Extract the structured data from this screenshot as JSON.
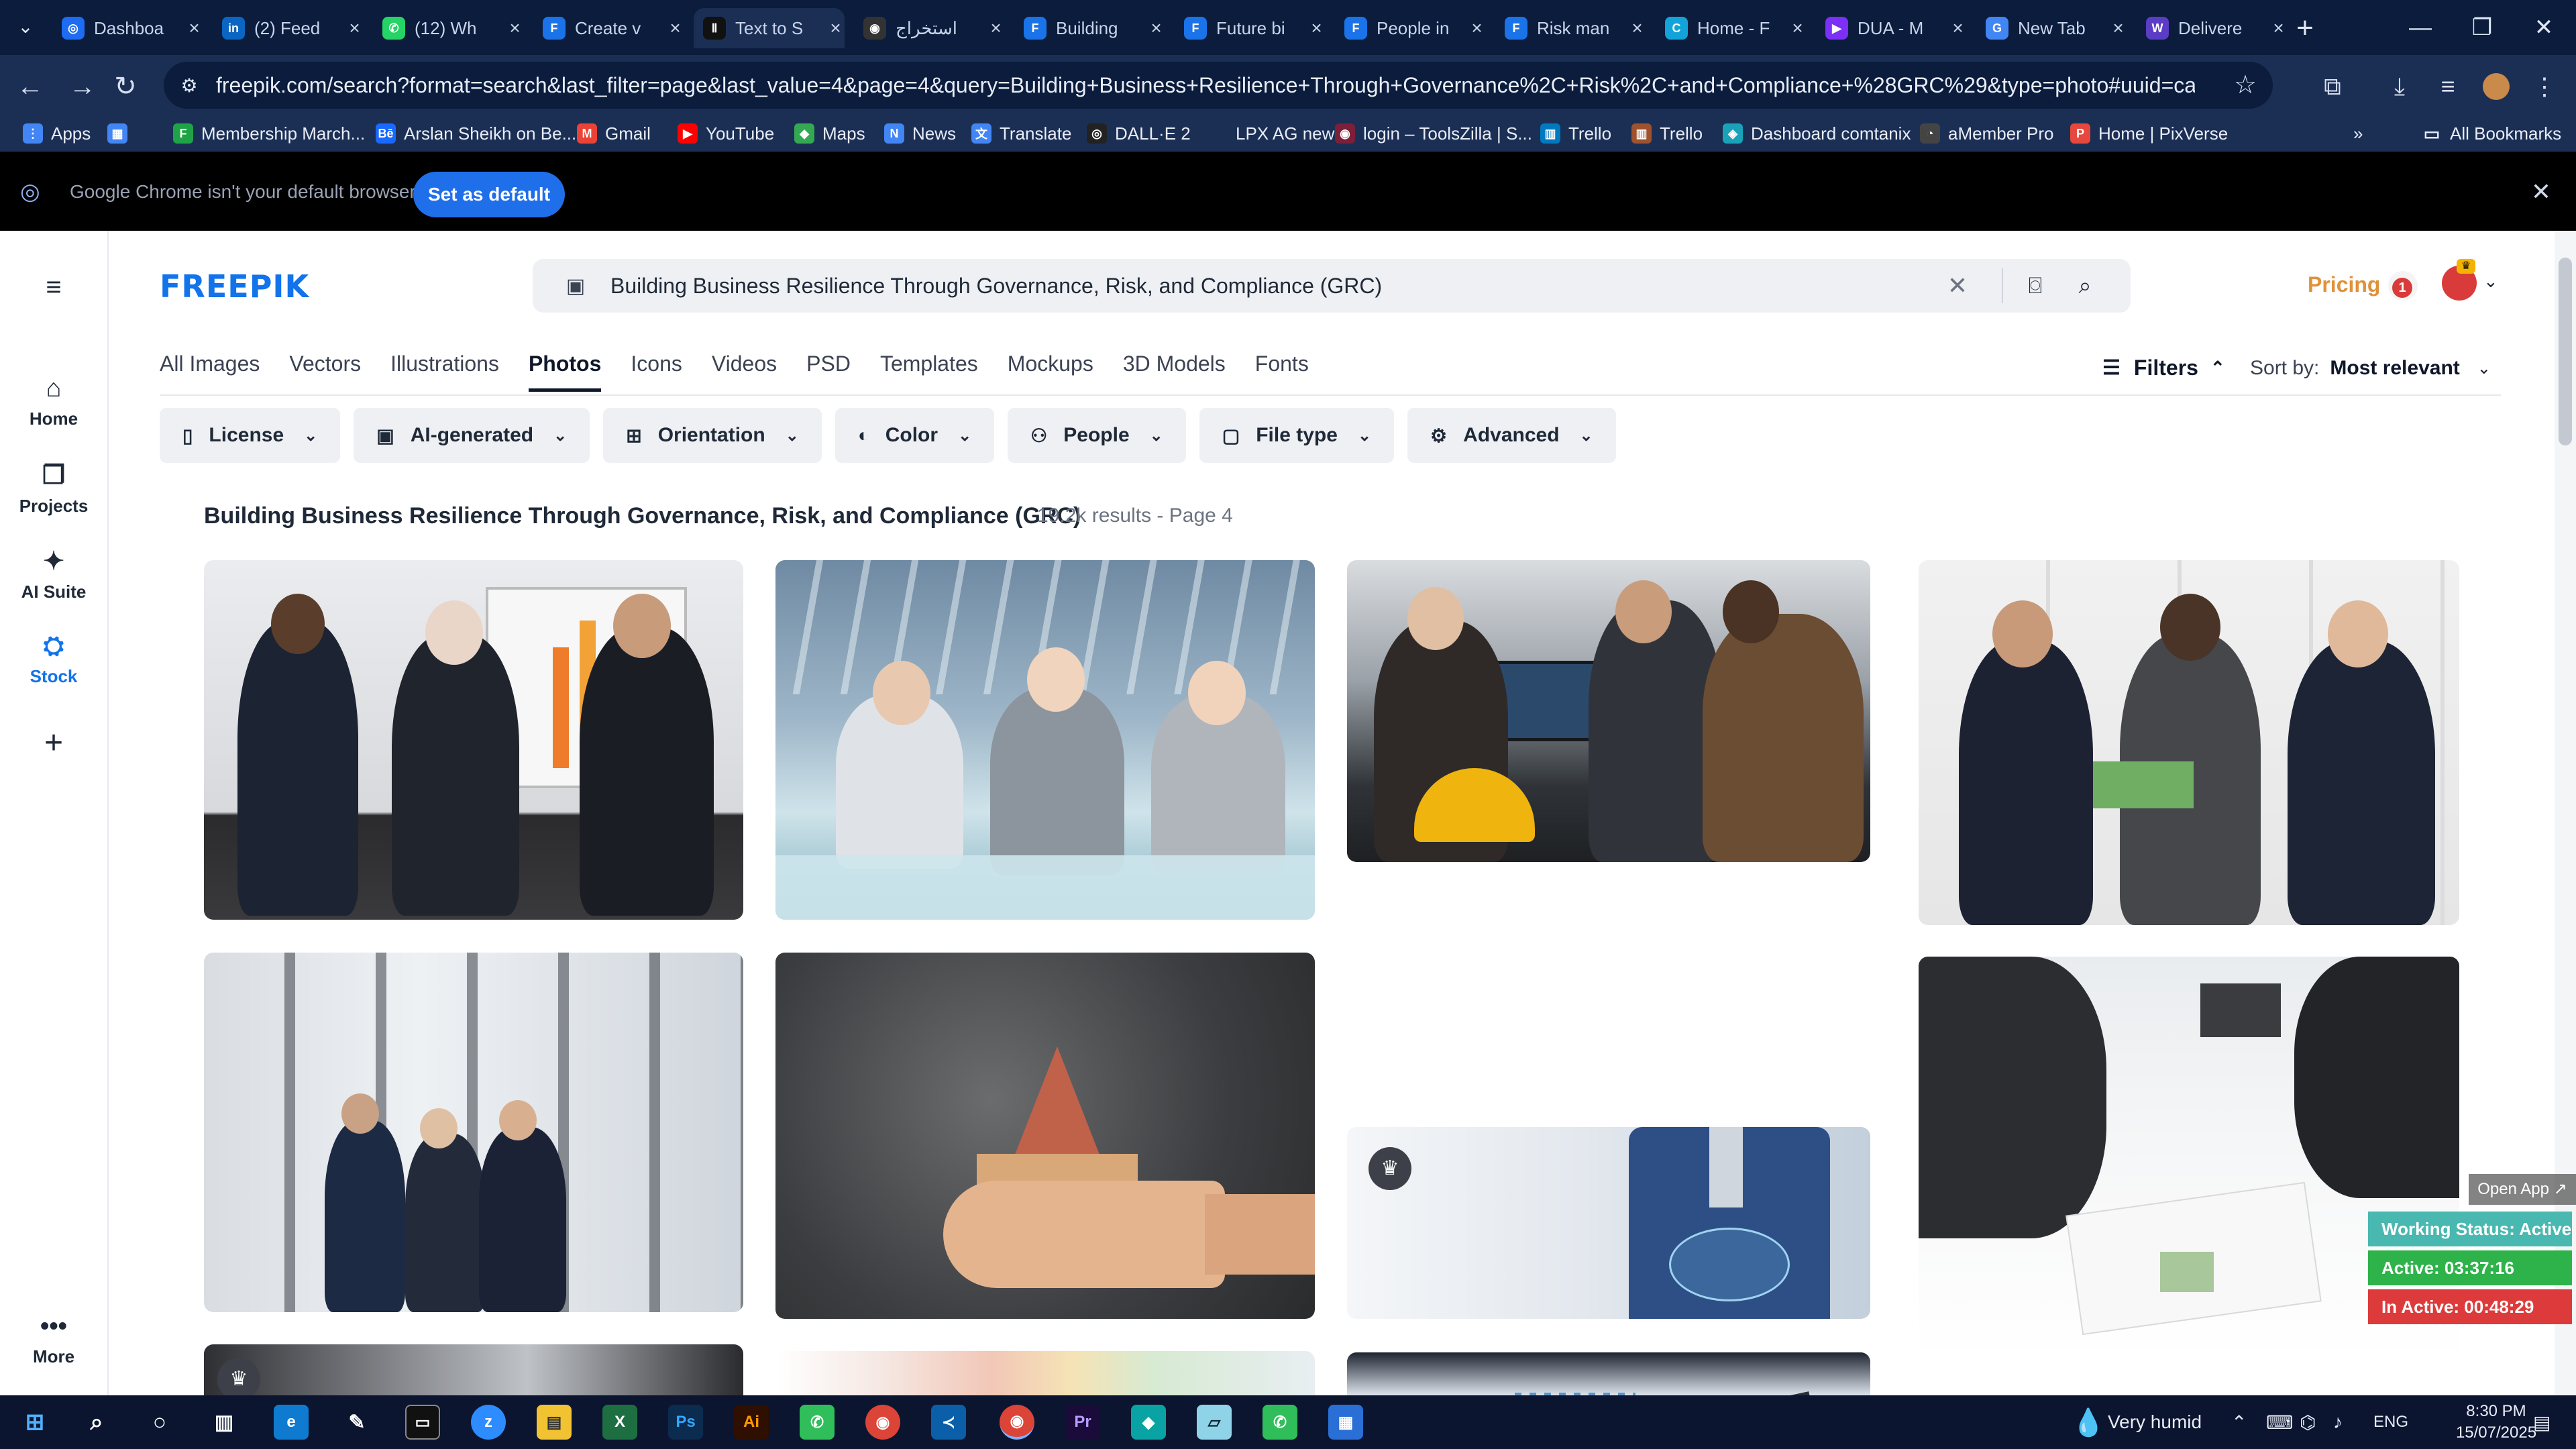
{
  "browser": {
    "tabs": [
      {
        "title": "Dashboa",
        "color": "#1d6cf2",
        "glyph": "◎"
      },
      {
        "title": "(2) Feed",
        "color": "#0a66c2",
        "glyph": "in"
      },
      {
        "title": "(12) Wh",
        "color": "#25d366",
        "glyph": "✆"
      },
      {
        "title": "Create v",
        "color": "#1a73e8",
        "glyph": "F"
      },
      {
        "title": "Text to S",
        "color": "#111111",
        "glyph": "Ⅱ"
      },
      {
        "title": "استخراج",
        "color": "#333333",
        "glyph": "◉"
      },
      {
        "title": "Building",
        "color": "#1a73e8",
        "glyph": "F"
      },
      {
        "title": "Future bi",
        "color": "#1a73e8",
        "glyph": "F"
      },
      {
        "title": "People in",
        "color": "#1a73e8",
        "glyph": "F"
      },
      {
        "title": "Risk man",
        "color": "#1a73e8",
        "glyph": "F"
      },
      {
        "title": "Home - F",
        "color": "#12a4d8",
        "glyph": "C"
      },
      {
        "title": "DUA - M",
        "color": "#7b2ff7",
        "glyph": "▶"
      },
      {
        "title": "New Tab",
        "color": "#4285f4",
        "glyph": "G"
      },
      {
        "title": "Delivere",
        "color": "#5b3cc4",
        "glyph": "W"
      }
    ],
    "new_tab_label": "+",
    "url": "freepik.com/search?format=search&last_filter=page&last_value=4&page=4&query=Building+Business+Resilience+Through+Governance%2C+Risk%2C+and+Compliance+%28GRC%29&type=photo#uuid=ca2fac46-376d-4ca8-8abf-f91f3712...",
    "bookmarks": [
      {
        "label": "Apps",
        "color": "#4285f4",
        "glyph": "⋮"
      },
      {
        "label": "",
        "color": "#4285f4",
        "glyph": "▦"
      },
      {
        "label": "Membership March...",
        "color": "#1ea446",
        "glyph": "F"
      },
      {
        "label": "Arslan Sheikh on Be...",
        "color": "#1769ff",
        "glyph": "Bē"
      },
      {
        "label": "Gmail",
        "color": "#ea4335",
        "glyph": "M"
      },
      {
        "label": "YouTube",
        "color": "#ff0000",
        "glyph": "▶"
      },
      {
        "label": "Maps",
        "color": "#34a853",
        "glyph": "◆"
      },
      {
        "label": "News",
        "color": "#4285f4",
        "glyph": "N"
      },
      {
        "label": "Translate",
        "color": "#4285f4",
        "glyph": "文"
      },
      {
        "label": "DALL·E 2",
        "color": "#222222",
        "glyph": "◎"
      },
      {
        "label": "LPX AG new",
        "color": "#1b2f55",
        "glyph": ""
      },
      {
        "label": "login – ToolsZilla | S...",
        "color": "#7b1f3a",
        "glyph": "◉"
      },
      {
        "label": "Trello",
        "color": "#0079bf",
        "glyph": "▥"
      },
      {
        "label": "Trello",
        "color": "#a0522d",
        "glyph": "▥"
      },
      {
        "label": "Dashboard comtanix",
        "color": "#1aa3b8",
        "glyph": "◈"
      },
      {
        "label": "aMember Pro",
        "color": "#444444",
        "glyph": "◔"
      },
      {
        "label": "Home | PixVerse",
        "color": "#e6483d",
        "glyph": "P"
      }
    ],
    "all_bookmarks_label": "All Bookmarks",
    "infobar_text": "Google Chrome isn't your default browser",
    "set_default_label": "Set as default"
  },
  "sidebar": {
    "items": [
      {
        "label": "Home",
        "icon": "home-icon",
        "glyph": "⌂"
      },
      {
        "label": "Projects",
        "icon": "projects-icon",
        "glyph": "❐"
      },
      {
        "label": "AI Suite",
        "icon": "ai-suite-icon",
        "glyph": "✦"
      },
      {
        "label": "Stock",
        "icon": "stock-icon",
        "glyph": "⛭"
      }
    ],
    "add_label": "+",
    "more_label": "More"
  },
  "header": {
    "logo": "FREEPIK",
    "search_value": "Building Business Resilience Through Governance, Risk, and Compliance (GRC)",
    "pricing_label": "Pricing",
    "notification_count": "1"
  },
  "category_tabs": [
    "All Images",
    "Vectors",
    "Illustrations",
    "Photos",
    "Icons",
    "Videos",
    "PSD",
    "Templates",
    "Mockups",
    "3D Models",
    "Fonts"
  ],
  "active_category": "Photos",
  "filters_label": "Filters",
  "sort": {
    "label": "Sort by:",
    "value": "Most relevant"
  },
  "filter_chips": [
    {
      "label": "License",
      "glyph": "▯"
    },
    {
      "label": "AI-generated",
      "glyph": "▣"
    },
    {
      "label": "Orientation",
      "glyph": "⊞"
    },
    {
      "label": "Color",
      "glyph": "◐"
    },
    {
      "label": "People",
      "glyph": "⚇"
    },
    {
      "label": "File type",
      "glyph": "▢"
    },
    {
      "label": "Advanced",
      "glyph": "⚙"
    }
  ],
  "results": {
    "heading": "Building Business Resilience Through Governance, Risk, and Compliance (GRC)",
    "meta": "19.2k results - Page 4"
  },
  "tracker": {
    "open_app": "Open App ↗",
    "working_status": "Working Status: Active",
    "active": "Active: 03:37:16",
    "inactive": "In Active: 00:48:29"
  },
  "taskbar": {
    "weather": "Very humid",
    "language": "ENG",
    "time": "8:30 PM",
    "date": "15/07/2025"
  }
}
